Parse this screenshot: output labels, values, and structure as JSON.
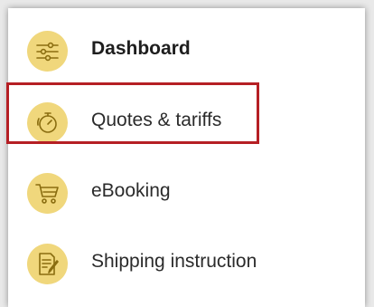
{
  "menu": {
    "items": [
      {
        "label": "Dashboard",
        "icon": "sliders-icon",
        "active": true
      },
      {
        "label": "Quotes & tariffs",
        "icon": "stopwatch-icon",
        "highlighted": true
      },
      {
        "label": "eBooking",
        "icon": "shopping-cart-icon"
      },
      {
        "label": "Shipping instruction",
        "icon": "document-pen-icon"
      }
    ]
  },
  "colors": {
    "icon_background": "#f0d77c",
    "icon_line": "#8a6d10",
    "highlight_border": "#b51f24",
    "text": "#2b2b2b"
  }
}
